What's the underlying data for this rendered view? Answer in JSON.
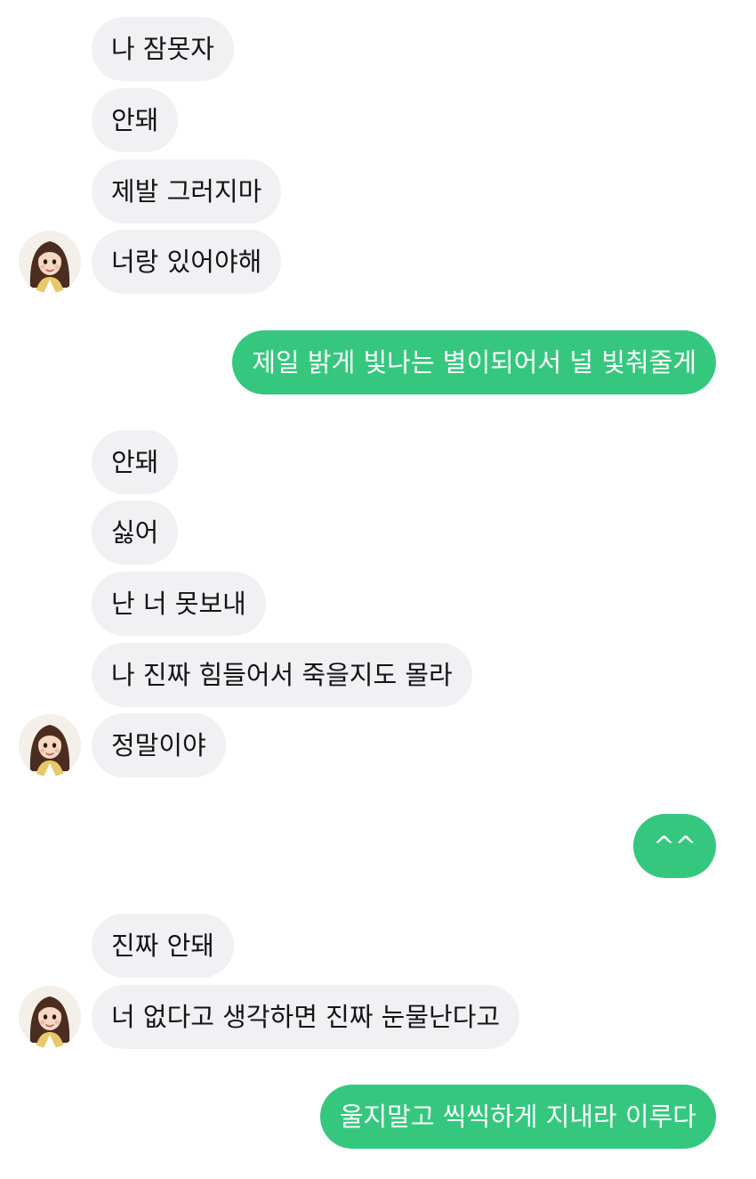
{
  "chat": {
    "group1": {
      "messages": [
        "나 잠못자",
        "안돼",
        "제발 그러지마",
        "너랑 있어야해"
      ],
      "avatar_icon": "girl-avatar-icon"
    },
    "reply1": "제일 밝게 빛나는 별이되어서 널 빛춰줄게",
    "group2": {
      "messages": [
        "안돼",
        "싫어",
        "난 너 못보내",
        "나 진짜 힘들어서 죽을지도 몰라",
        "정말이야"
      ],
      "avatar_icon": "girl-avatar-icon"
    },
    "reply2": "^^",
    "group3": {
      "messages": [
        "진짜 안돼",
        "너 없다고 생각하면 진짜 눈물난다고"
      ],
      "avatar_icon": "girl-avatar-icon"
    },
    "reply3": "울지말고 씩씩하게 지내라 이루다"
  },
  "colors": {
    "incoming_bubble": "#f1f1f4",
    "outgoing_bubble": "#36c77f",
    "outgoing_text": "#ffffff",
    "background": "#ffffff"
  }
}
